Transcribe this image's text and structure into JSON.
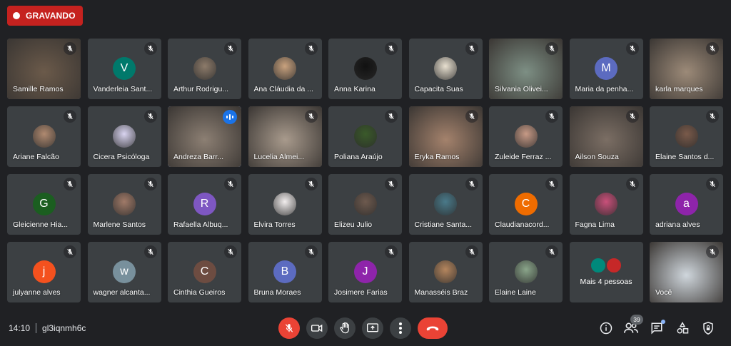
{
  "recording": {
    "label": "GRAVANDO"
  },
  "meeting": {
    "time": "14:10",
    "code": "gl3iqnmh6c"
  },
  "participants_badge": "39",
  "tiles": [
    {
      "name": "Samille Ramos",
      "type": "video",
      "bg": "#6b5a4a",
      "muted": true
    },
    {
      "name": "Vanderleia Sant...",
      "type": "letter",
      "letter": "V",
      "color": "#00796b",
      "muted": true
    },
    {
      "name": "Arthur Rodrigu...",
      "type": "photo",
      "color": "#8d7b6a",
      "muted": true
    },
    {
      "name": "Ana Cláudia da ...",
      "type": "photo",
      "color": "#c9a27e",
      "muted": true
    },
    {
      "name": "Anna Karina",
      "type": "photo",
      "color": "#111111",
      "muted": true
    },
    {
      "name": "Capacita Suas",
      "type": "photo",
      "color": "#e8e0d0",
      "muted": true
    },
    {
      "name": "Silvania Olivei...",
      "type": "video",
      "bg": "#7d8f84",
      "muted": true
    },
    {
      "name": "Maria da penha...",
      "type": "letter",
      "letter": "M",
      "color": "#5c6bc0",
      "muted": true
    },
    {
      "name": "karla marques",
      "type": "video",
      "bg": "#9c8a78",
      "muted": true
    },
    {
      "name": "Ariane Falcão",
      "type": "photo",
      "color": "#b08a70",
      "muted": true
    },
    {
      "name": "Cicera Psicóloga",
      "type": "photo",
      "color": "#d9d4f0",
      "muted": true
    },
    {
      "name": "Andreza Barr...",
      "type": "video",
      "bg": "#8c7f73",
      "muted": false,
      "active": true
    },
    {
      "name": "Lucelia Almei...",
      "type": "video",
      "bg": "#a89a8c",
      "muted": true
    },
    {
      "name": "Poliana Araújo",
      "type": "photo",
      "color": "#3a5a2a",
      "muted": true
    },
    {
      "name": "Eryka Ramos",
      "type": "video",
      "bg": "#a4826c",
      "muted": true
    },
    {
      "name": "Zuleide Ferraz ...",
      "type": "photo",
      "color": "#c79a86",
      "muted": true
    },
    {
      "name": "Ailson Souza",
      "type": "video",
      "bg": "#7b6e64",
      "muted": true
    },
    {
      "name": "Elaine Santos d...",
      "type": "photo",
      "color": "#7a5a4a",
      "muted": true
    },
    {
      "name": "Gleicienne Hia...",
      "type": "letter",
      "letter": "G",
      "color": "#1b5e20",
      "muted": true
    },
    {
      "name": "Marlene Santos",
      "type": "photo",
      "color": "#a07a68",
      "muted": true
    },
    {
      "name": "Rafaella Albuq...",
      "type": "letter",
      "letter": "R",
      "color": "#7e57c2",
      "muted": true
    },
    {
      "name": "Elvira Torres",
      "type": "photo",
      "color": "#f2eeee",
      "muted": true
    },
    {
      "name": "Elizeu Julio",
      "type": "photo",
      "color": "#6e5a4e",
      "muted": true
    },
    {
      "name": "Cristiane Santa...",
      "type": "photo",
      "color": "#4a7a8a",
      "muted": true
    },
    {
      "name": "Claudianacord...",
      "type": "letter",
      "letter": "C",
      "color": "#ef6c00",
      "muted": true
    },
    {
      "name": "Fagna Lima",
      "type": "photo",
      "color": "#c9507a",
      "muted": true
    },
    {
      "name": "adriana alves",
      "type": "letter",
      "letter": "a",
      "color": "#8e24aa",
      "muted": true
    },
    {
      "name": "julyanne alves",
      "type": "letter",
      "letter": "j",
      "color": "#f4511e",
      "muted": true
    },
    {
      "name": "wagner alcanta...",
      "type": "letter",
      "letter": "w",
      "color": "#78909c",
      "muted": true
    },
    {
      "name": "Cinthia Gueiros",
      "type": "letter",
      "letter": "C",
      "color": "#6d4c41",
      "muted": true
    },
    {
      "name": "Bruna Moraes",
      "type": "letter",
      "letter": "B",
      "color": "#5c6bc0",
      "muted": true
    },
    {
      "name": "Josimere Farias",
      "type": "letter",
      "letter": "J",
      "color": "#8e24aa",
      "muted": true
    },
    {
      "name": "Manasséis Braz",
      "type": "photo",
      "color": "#b5865e",
      "muted": true
    },
    {
      "name": "Elaine Laine",
      "type": "photo",
      "color": "#8aa58a",
      "muted": true
    },
    {
      "name": "Mais 4 pessoas",
      "type": "more",
      "muted": false
    },
    {
      "name": "Você",
      "type": "video",
      "bg": "#cfd6dc",
      "muted": true
    }
  ],
  "controls": {
    "mic": "mic-off-icon",
    "camera": "camera-icon",
    "raise_hand": "hand-icon",
    "present": "present-icon",
    "more": "more-icon",
    "hangup": "hangup-icon"
  }
}
